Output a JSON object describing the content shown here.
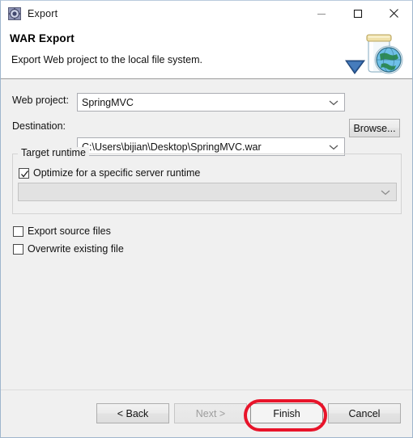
{
  "window": {
    "title": "Export",
    "icon": "export-wizard-icon",
    "controls": {
      "minimize": "minimize-icon",
      "maximize": "maximize-icon",
      "close": "close-icon"
    }
  },
  "header": {
    "title": "WAR Export",
    "description": "Export Web project to the local file system.",
    "banner_icon": "war-jar-globe-icon"
  },
  "form": {
    "web_project": {
      "label": "Web project:",
      "value": "SpringMVC",
      "placeholder": ""
    },
    "destination": {
      "label": "Destination:",
      "value": "C:\\Users\\bijian\\Desktop\\SpringMVC.war",
      "placeholder": "",
      "browse_label": "Browse..."
    },
    "target_runtime": {
      "legend": "Target runtime",
      "optimize": {
        "label": "Optimize for a specific server runtime",
        "checked": true
      },
      "runtime_select": {
        "value": "",
        "enabled": false
      }
    },
    "export_source_files": {
      "label": "Export source files",
      "checked": false
    },
    "overwrite_existing_file": {
      "label": "Overwrite existing file",
      "checked": false
    }
  },
  "footer": {
    "back_label": "< Back",
    "next_label": "Next >",
    "finish_label": "Finish",
    "cancel_label": "Cancel"
  },
  "annotation": {
    "type": "highlight-ring",
    "target": "finish-button",
    "color": "#e8142a"
  }
}
